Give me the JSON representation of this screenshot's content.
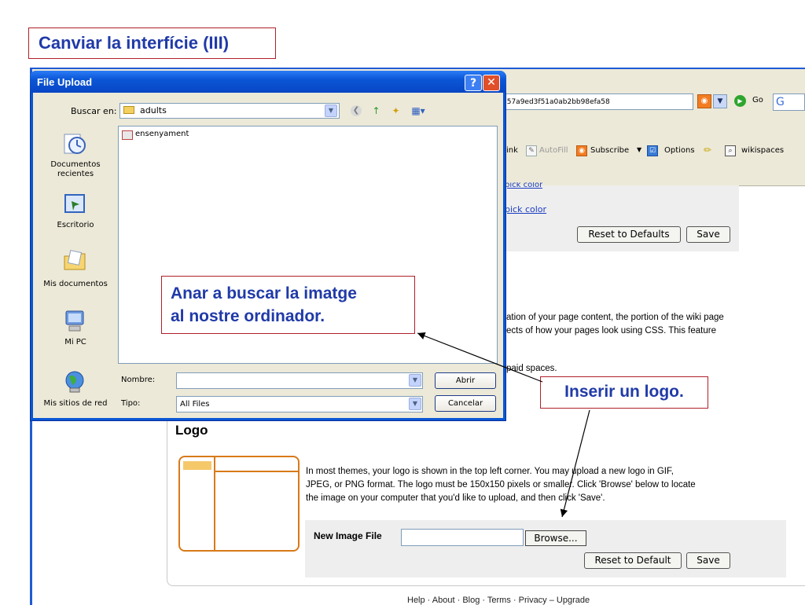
{
  "slide": {
    "title": "Canviar la interfície (III)"
  },
  "browser": {
    "address_fragment": "857a9ed3f51a0ab2bb98efa58",
    "go_label": "Go",
    "search_start": "G",
    "toolbar": {
      "link_fragment": "ink",
      "autofill": "AutoFill",
      "subscribe": "Subscribe",
      "options": "Options",
      "wikispaces": "wikispaces"
    }
  },
  "page": {
    "pick_color_partial": "pick color",
    "pick_color": "pick color",
    "reset_defaults": "Reset to Defaults",
    "save": "Save",
    "style_text_line1": "ation of your page content, the portion of the wiki page",
    "style_text_line2": "ects of how your pages look using CSS. This feature",
    "paid_spaces": "paid spaces.",
    "logo_heading": "Logo",
    "logo_desc_1": "In most themes, your logo is shown in the top left corner. You may upload a new logo in GIF,",
    "logo_desc_2": "JPEG, or PNG format. The logo must be 150x150 pixels or smaller. Click 'Browse' below to locate",
    "logo_desc_3": "the image on your computer that you'd like to upload, and then click 'Save'.",
    "new_image_file": "New Image File",
    "browse": "Browse...",
    "reset_default": "Reset to Default",
    "save2": "Save",
    "footer": "Help · About · Blog · Terms · Privacy  –  Upgrade"
  },
  "dialog": {
    "title": "File Upload",
    "help": "?",
    "close": "✕",
    "look_in_label": "Buscar en:",
    "look_in_value": "adults",
    "places": [
      "Documentos recientes",
      "Escritorio",
      "Mis documentos",
      "Mi PC",
      "Mis sitios de red"
    ],
    "files": [
      "ensenyament"
    ],
    "name_label": "Nombre:",
    "name_value": "",
    "type_label": "Tipo:",
    "type_value": "All Files",
    "open_button": "Abrir",
    "cancel_button": "Cancelar"
  },
  "callouts": {
    "browse_hint_1": "Anar a buscar la imatge",
    "browse_hint_2": "al nostre ordinador.",
    "logo_hint": "Inserir un logo."
  },
  "colors": {
    "annotation_border": "#b0202a",
    "annotation_text": "#203aa8",
    "xp_title_blue": "#0a57d4",
    "dialog_face": "#ece9d8",
    "logo_orange": "#d87a18"
  }
}
